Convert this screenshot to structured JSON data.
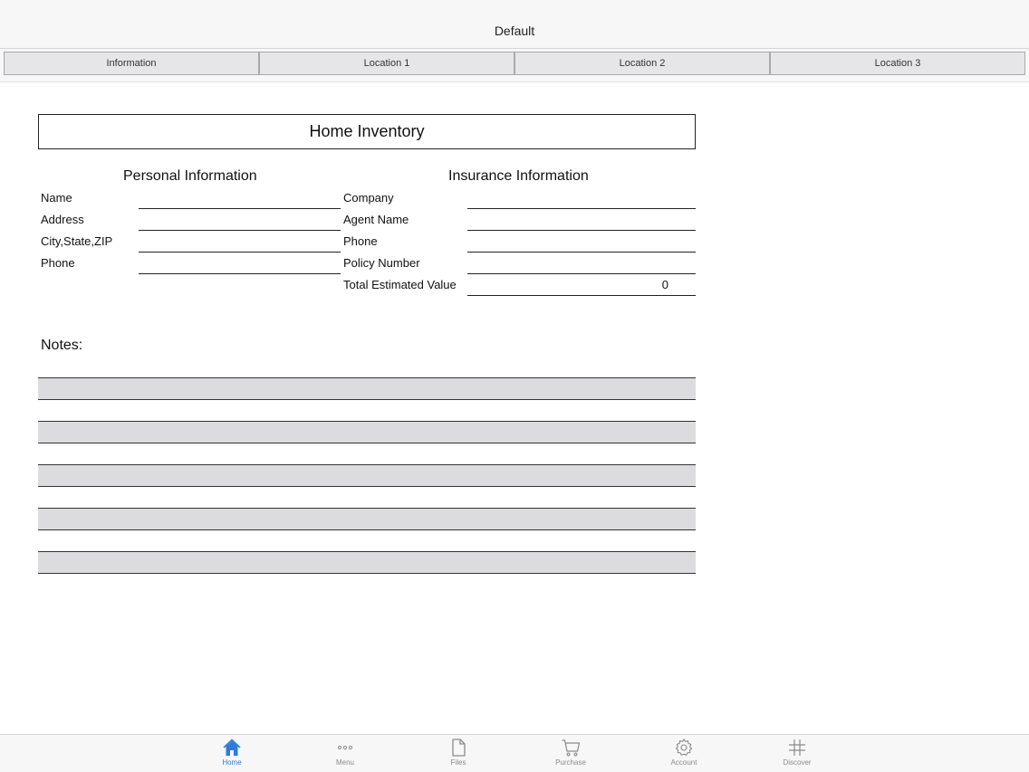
{
  "nav": {
    "title": "Default"
  },
  "tabs": [
    "Information",
    "Location 1",
    "Location 2",
    "Location 3"
  ],
  "form": {
    "title": "Home Inventory",
    "personal": {
      "heading": "Personal Information",
      "fields": [
        {
          "label": "Name",
          "value": ""
        },
        {
          "label": "Address",
          "value": ""
        },
        {
          "label": "City,State,ZIP",
          "value": ""
        },
        {
          "label": "Phone",
          "value": ""
        }
      ]
    },
    "insurance": {
      "heading": "Insurance Information",
      "fields": [
        {
          "label": "Company",
          "value": ""
        },
        {
          "label": "Agent Name",
          "value": ""
        },
        {
          "label": "Phone",
          "value": ""
        },
        {
          "label": "Policy Number",
          "value": ""
        }
      ],
      "total_label": "Total Estimated Value",
      "total_value": "0"
    },
    "notes_label": "Notes:"
  },
  "tabbar": {
    "items": [
      {
        "label": "Home",
        "icon": "home-icon"
      },
      {
        "label": "Menu",
        "icon": "ellipsis-icon"
      },
      {
        "label": "Files",
        "icon": "file-icon"
      },
      {
        "label": "Purchase",
        "icon": "cart-icon"
      },
      {
        "label": "Account",
        "icon": "gear-icon"
      },
      {
        "label": "Discover",
        "icon": "grid-icon"
      }
    ],
    "active_color": "#2f7bdc",
    "inactive_color": "#8a8a8e"
  }
}
